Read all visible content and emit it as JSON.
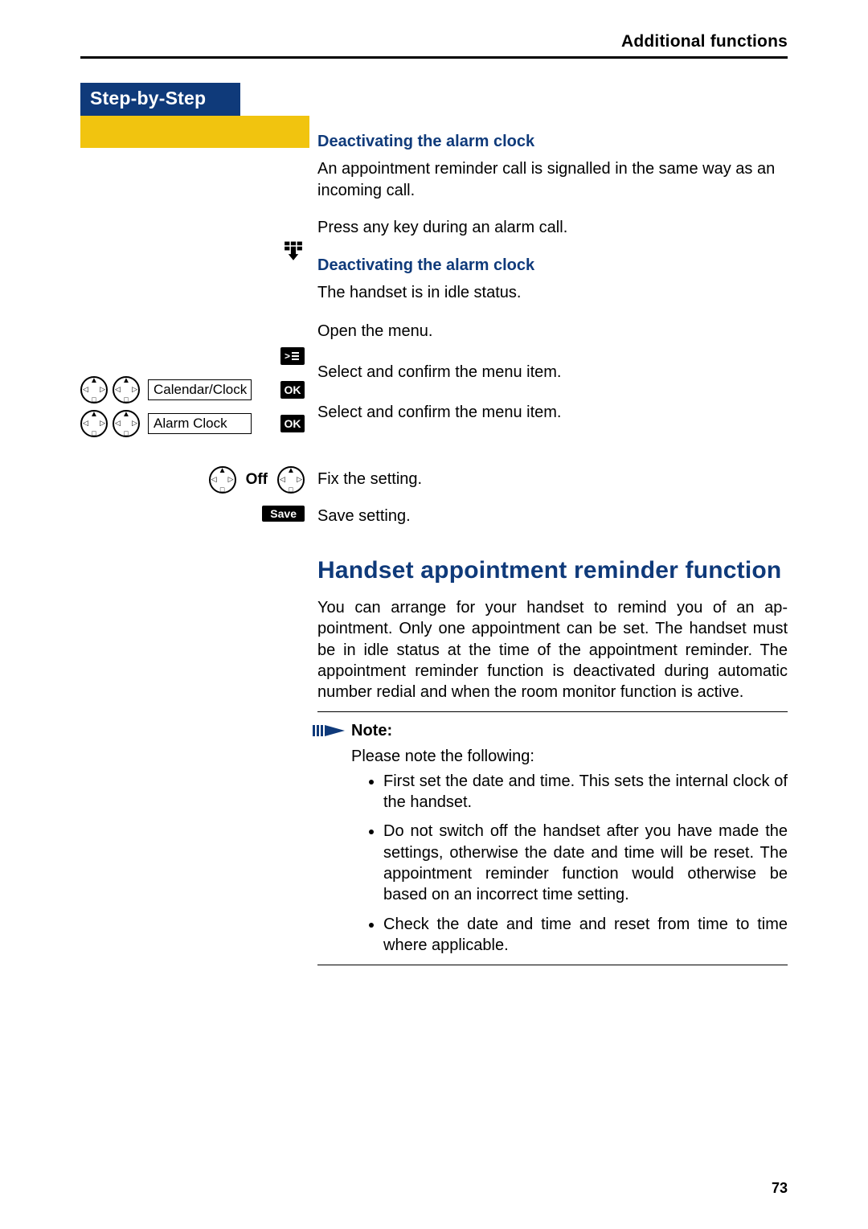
{
  "header": {
    "section": "Additional functions"
  },
  "sidebar": {
    "tab_title": "Step-by-Step",
    "menu_item_calendar": "Calendar/Clock",
    "menu_item_alarm": "Alarm Clock",
    "ok_label": "OK",
    "off_label": "Off",
    "save_label": "Save"
  },
  "content": {
    "sub1": "Deactivating the alarm clock",
    "p1": "An appointment reminder call is signalled in the same way as an incoming call.",
    "step_press_key": "Press any key during an alarm call.",
    "sub2": "Deactivating the alarm clock",
    "p2": "The handset is in idle status.",
    "step_open_menu": "Open the menu.",
    "step_select_confirm_1": "Select and confirm the menu item.",
    "step_select_confirm_2": "Select and confirm the menu item.",
    "step_fix_setting": "Fix the setting.",
    "step_save_setting": "Save setting.",
    "big_heading": "Handset appointment reminder func­tion",
    "p3": "You can arrange for your handset to remind you of an ap­pointment. Only one appointment can be set. The hand­set must be in idle status at the time of the appoint­ment reminder. The appointment reminder function is deactivated during automatic number redial and when the room monitor function is active.",
    "note_title": "Note:",
    "note_lead": "Please note the following:",
    "note_items": [
      "First set the date and time. This sets the in­ternal clock of the handset.",
      "Do not switch off the handset after you have made the settings, otherwise the date and time will be reset. The appointment reminder function would otherwise be based on an in­correct time setting.",
      "Check the date and time and reset from time to time where applicable."
    ]
  },
  "page_number": "73"
}
